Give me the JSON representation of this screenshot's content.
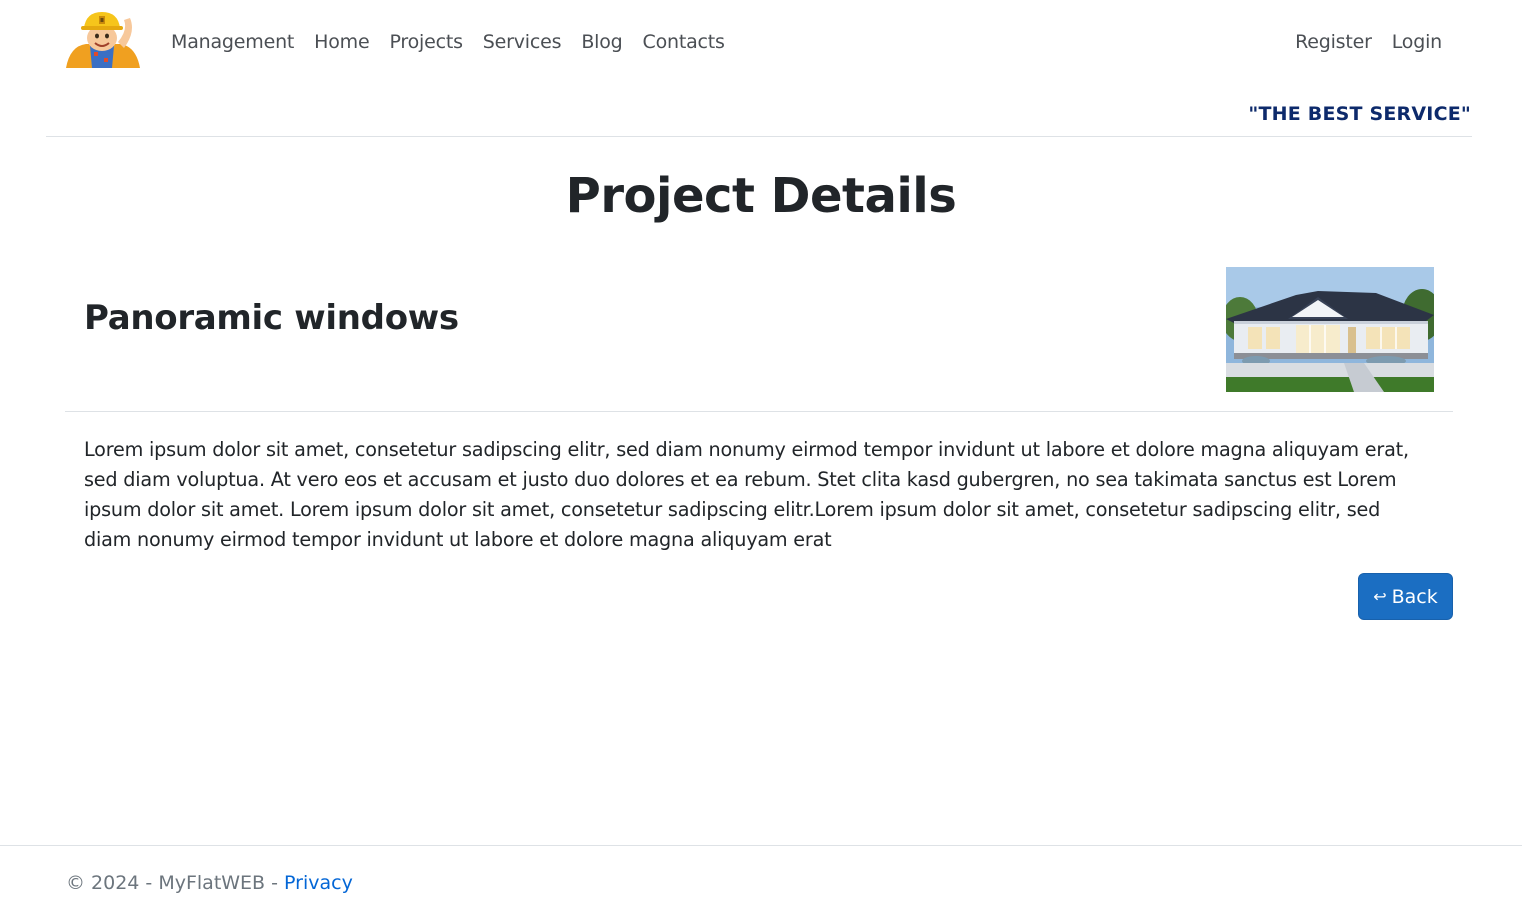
{
  "header": {
    "logo_icon": "construction-worker-mascot-icon",
    "nav_left": [
      "Management",
      "Home",
      "Projects",
      "Services",
      "Blog",
      "Contacts"
    ],
    "nav_right": [
      "Register",
      "Login"
    ],
    "tagline": "\"THE BEST SERVICE\""
  },
  "main": {
    "title": "Project Details",
    "project_name": "Panoramic windows",
    "project_image": "house-photo",
    "description": "Lorem ipsum dolor sit amet, consetetur sadipscing elitr, sed diam nonumy eirmod tempor invidunt ut labore et dolore magna aliquyam erat, sed diam voluptua. At vero eos et accusam et justo duo dolores et ea rebum. Stet clita kasd gubergren, no sea takimata sanctus est Lorem ipsum dolor sit amet. Lorem ipsum dolor sit amet, consetetur sadipscing elitr.Lorem ipsum dolor sit amet, consetetur sadipscing elitr, sed diam nonumy eirmod tempor invidunt ut labore et dolore magna aliquyam erat",
    "back_button": {
      "icon": "return-arrow-icon",
      "arrow": "↩",
      "label": "Back",
      "color": "#1b6ec2"
    }
  },
  "footer": {
    "copyright": "© 2024 - MyFlatWEB - ",
    "privacy_link": "Privacy"
  },
  "colors": {
    "link": "#0366d6",
    "tagline": "#0d2a6b",
    "primary": "#1b6ec2"
  }
}
